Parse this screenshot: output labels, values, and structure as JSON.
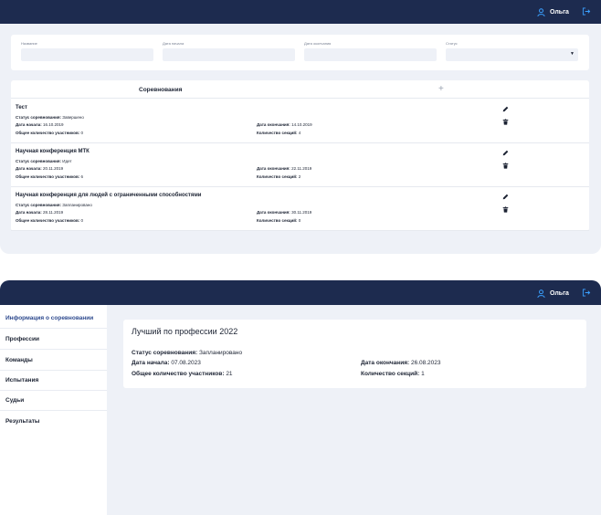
{
  "screen1": {
    "header": {
      "user_name": "Ольга"
    },
    "filters": {
      "name_label": "Название",
      "start_label": "Дата начала",
      "end_label": "Дата окончания",
      "status_label": "Статус"
    },
    "list": {
      "title": "Соревнования",
      "add_symbol": "+",
      "field_labels": {
        "status": "Статус соревнования: ",
        "start": "Дата начала: ",
        "end": "Дата окончания: ",
        "participants": "Общее количество участников: ",
        "sections": "Количество секций: "
      },
      "items": [
        {
          "name": "Тест",
          "status": "Завершено",
          "start": "16.10.2019",
          "end": "14.10.2019",
          "participants": "0",
          "sections": "4"
        },
        {
          "name": "Научная конференция МТК",
          "status": "Идет",
          "start": "20.11.2019",
          "end": "22.11.2019",
          "participants": "6",
          "sections": "2"
        },
        {
          "name": "Научная конференция для людей с ограниченными способностями",
          "status": "Запланировано",
          "start": "28.11.2019",
          "end": "30.11.2019",
          "participants": "0",
          "sections": "0"
        }
      ]
    }
  },
  "screen2": {
    "header": {
      "user_name": "Ольга"
    },
    "sidebar": {
      "items": [
        {
          "label": "Информация о соревновании"
        },
        {
          "label": "Профессии"
        },
        {
          "label": "Команды"
        },
        {
          "label": "Испытания"
        },
        {
          "label": "Судьи"
        },
        {
          "label": "Результаты"
        }
      ]
    },
    "card": {
      "title": "Лучший по профессии 2022",
      "status_label": "Статус соревнования: ",
      "status": "Запланировано",
      "start_label": "Дата начала: ",
      "start": "07.08.2023",
      "end_label": "Дата окончания: ",
      "end": "26.08.2023",
      "participants_label": "Общее количество участников: ",
      "participants": "21",
      "sections_label": "Количество секций: ",
      "sections": "1"
    }
  },
  "colors": {
    "header": "#1d2b4f",
    "background": "#eef1f7",
    "accent": "#3aa0ff",
    "active_nav": "#2e4a8e"
  },
  "icons": {
    "user": "user-icon",
    "logout": "logout-icon",
    "edit": "pencil-icon",
    "delete": "trash-icon",
    "add": "plus-icon",
    "dropdown": "chevron-down-icon"
  }
}
